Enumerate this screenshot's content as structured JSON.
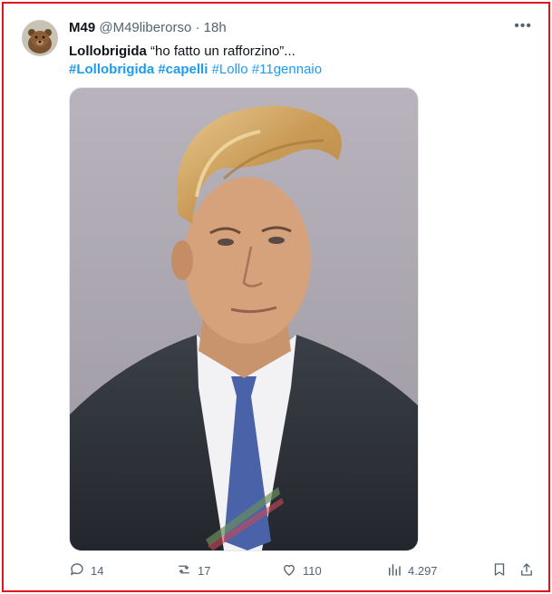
{
  "tweet": {
    "author_name": "M49",
    "handle": "@M49liberorso",
    "separator": "·",
    "time": "18h",
    "text_bold": "Lollobrigida",
    "text_rest": " “ho fatto un rafforzino”...",
    "hashtags_bold": [
      "#Lollobrigida",
      "#capelli"
    ],
    "hashtags": [
      "#Lollo",
      "#11gennaio"
    ],
    "more_label": "•••"
  },
  "actions": {
    "replies": "14",
    "retweets": "17",
    "likes": "110",
    "views": "4.297"
  },
  "icons": {
    "reply": "reply-icon",
    "retweet": "retweet-icon",
    "like": "heart-icon",
    "views": "views-icon",
    "bookmark": "bookmark-icon",
    "share": "share-icon"
  },
  "colors": {
    "border": "#e1141b",
    "link": "#1d9bf0",
    "muted": "#536471"
  }
}
